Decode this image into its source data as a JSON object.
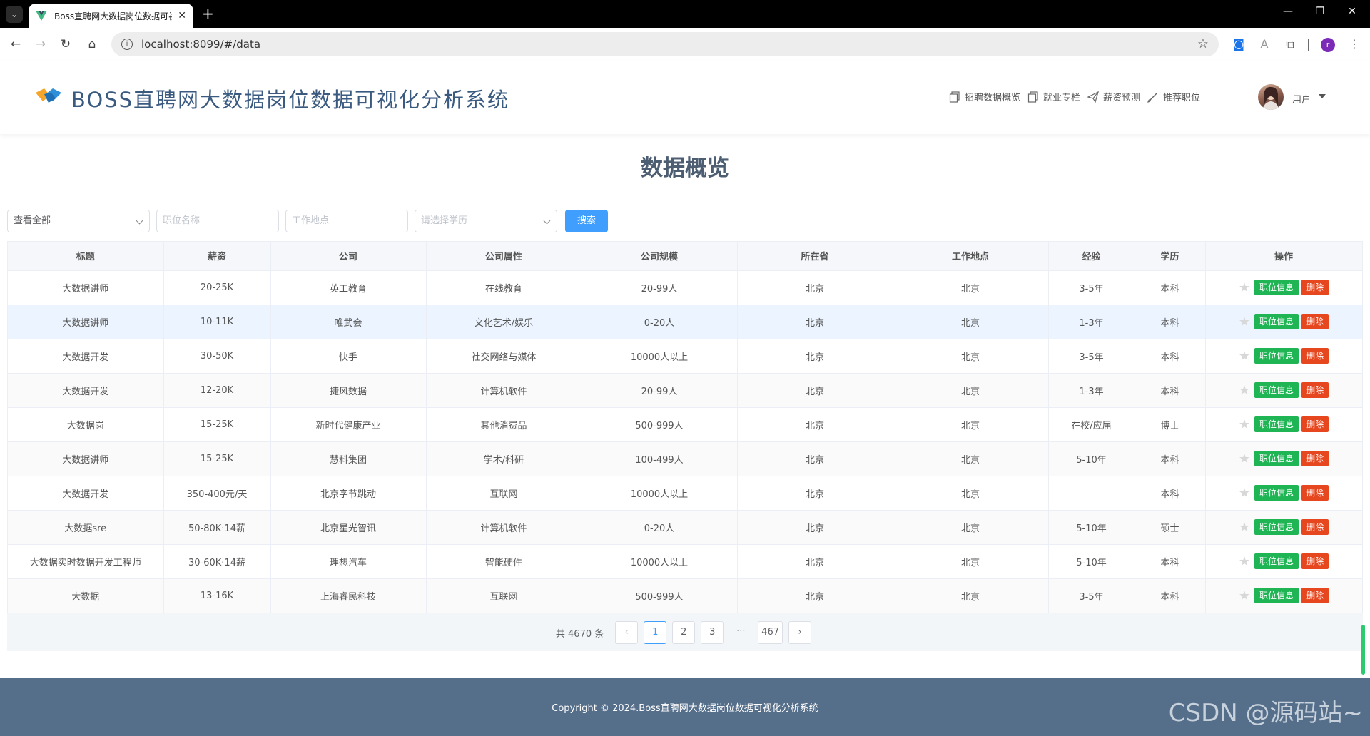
{
  "browser": {
    "tab_title": "Boss直聘网大数据岗位数据可视化分析系统",
    "url": "localhost:8099/#/data",
    "profile_initial": "r"
  },
  "header": {
    "app_title": "BOSS直聘网大数据岗位数据可视化分析系统",
    "nav": [
      "招聘数据概览",
      "就业专栏",
      "薪资预测",
      "推荐职位"
    ],
    "user_label": "用户"
  },
  "page_title": "数据概览",
  "filters": {
    "scope": "查看全部",
    "job_placeholder": "职位名称",
    "location_placeholder": "工作地点",
    "education_placeholder": "请选择学历",
    "search_label": "搜索"
  },
  "table": {
    "columns": [
      "标题",
      "薪资",
      "公司",
      "公司属性",
      "公司规模",
      "所在省",
      "工作地点",
      "经验",
      "学历",
      "操作"
    ],
    "rows": [
      [
        "大数据讲师",
        "20-25K",
        "英工教育",
        "在线教育",
        "20-99人",
        "北京",
        "北京",
        "3-5年",
        "本科"
      ],
      [
        "大数据讲师",
        "10-11K",
        "唯武会",
        "文化艺术/娱乐",
        "0-20人",
        "北京",
        "北京",
        "1-3年",
        "本科"
      ],
      [
        "大数据开发",
        "30-50K",
        "快手",
        "社交网络与媒体",
        "10000人以上",
        "北京",
        "北京",
        "3-5年",
        "本科"
      ],
      [
        "大数据开发",
        "12-20K",
        "捷风数据",
        "计算机软件",
        "20-99人",
        "北京",
        "北京",
        "1-3年",
        "本科"
      ],
      [
        "大数据岗",
        "15-25K",
        "新时代健康产业",
        "其他消费品",
        "500-999人",
        "北京",
        "北京",
        "在校/应届",
        "博士"
      ],
      [
        "大数据讲师",
        "15-25K",
        "慧科集团",
        "学术/科研",
        "100-499人",
        "北京",
        "北京",
        "5-10年",
        "本科"
      ],
      [
        "大数据开发",
        "350-400元/天",
        "北京字节跳动",
        "互联网",
        "10000人以上",
        "北京",
        "北京",
        "",
        "本科"
      ],
      [
        "大数据sre",
        "50-80K·14薪",
        "北京星光智讯",
        "计算机软件",
        "0-20人",
        "北京",
        "北京",
        "5-10年",
        "硕士"
      ],
      [
        "大数据实时数据开发工程师",
        "30-60K·14薪",
        "理想汽车",
        "智能硬件",
        "10000人以上",
        "北京",
        "北京",
        "5-10年",
        "本科"
      ],
      [
        "大数据",
        "13-16K",
        "上海睿民科技",
        "互联网",
        "500-999人",
        "北京",
        "北京",
        "3-5年",
        "本科"
      ]
    ],
    "action_info_label": "职位信息",
    "action_delete_label": "删除"
  },
  "pagination": {
    "total_text": "共 4670 条",
    "pages": [
      "1",
      "2",
      "3",
      "···",
      "467"
    ],
    "current": "1"
  },
  "footer": {
    "copyright": "Copyright © 2024.Boss直聘网大数据岗位数据可视化分析系统",
    "watermark": "CSDN @源码站~"
  },
  "colors": {
    "primary": "#409eff",
    "success": "#1fb454",
    "danger": "#e6471f",
    "footer_bg": "#556e8a"
  }
}
